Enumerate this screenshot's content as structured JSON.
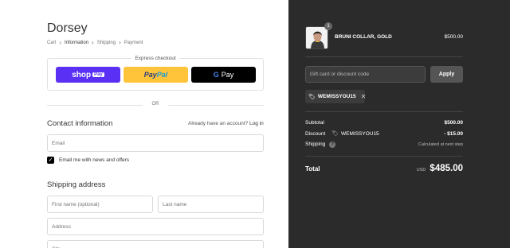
{
  "store": {
    "name": "Dorsey"
  },
  "breadcrumb": [
    "Cart",
    "Information",
    "Shipping",
    "Payment"
  ],
  "express": {
    "title": "Express checkout",
    "shoppay": {
      "shop": "shop",
      "pay": "Pay"
    },
    "paypal": {
      "pay": "Pay",
      "pal": "Pal"
    },
    "gpay": {
      "g": "G",
      "pay": "Pay"
    }
  },
  "or_label": "OR",
  "contact": {
    "title": "Contact information",
    "have_account": "Already have an account?",
    "login": "Log in",
    "email_placeholder": "Email",
    "newsletter_label": "Email me with news and offers",
    "newsletter_checked": true
  },
  "shipping": {
    "title": "Shipping address",
    "first_name_placeholder": "First name (optional)",
    "last_name_placeholder": "Last name",
    "address_placeholder": "Address",
    "city_placeholder": "City"
  },
  "summary": {
    "product": {
      "name": "BRUNI COLLAR, GOLD",
      "price": "$500.00",
      "quantity": "1"
    },
    "discount_placeholder": "Gift card or discount code",
    "apply_label": "Apply",
    "applied_code": "WEMISSYOU15",
    "subtotal_label": "Subtotal",
    "subtotal_value": "$500.00",
    "discount_label": "Discount",
    "discount_code": "WEMISSYOU15",
    "discount_value": "- $15.00",
    "shipping_label": "Shipping",
    "shipping_value": "Calculated at next step",
    "total_label": "Total",
    "currency": "USD",
    "total_value": "$485.00"
  },
  "colors": {
    "summary_bg": "#2b2b2b",
    "shoppay": "#5a31f4",
    "paypal": "#ffc439",
    "gpay": "#000000"
  },
  "icons": [
    "chevron-right-icon",
    "tag-icon",
    "close-icon",
    "question-icon",
    "check-icon"
  ]
}
